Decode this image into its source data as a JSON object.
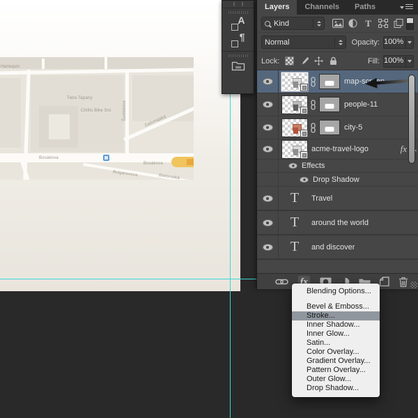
{
  "panel": {
    "tabs": [
      {
        "label": "Layers",
        "active": true
      },
      {
        "label": "Channels",
        "active": false
      },
      {
        "label": "Paths",
        "active": false
      }
    ],
    "filter_row": {
      "kind_label": "Kind",
      "filter_icons": [
        "filter-pixel-layers",
        "filter-adjustment-layers",
        "filter-type-layers",
        "filter-shape-layers",
        "filter-smart-objects"
      ],
      "toggle_icon": "layer-filtering-toggle"
    },
    "blend_row": {
      "blend_mode": "Normal",
      "opacity_label": "Opacity:",
      "opacity_value": "100%"
    },
    "lock_row": {
      "lock_label": "Lock:",
      "lock_icons": [
        "lock-transparency",
        "lock-pixels",
        "lock-position",
        "lock-all"
      ],
      "fill_label": "Fill:",
      "fill_value": "100%"
    },
    "layers": [
      {
        "name": "map-screen",
        "type": "image",
        "smart_object": true,
        "mask": true,
        "selected": true,
        "annotated": true
      },
      {
        "name": "people-11",
        "type": "image",
        "smart_object": true,
        "mask": true
      },
      {
        "name": "city-5",
        "type": "image",
        "smart_object": true,
        "mask": true
      },
      {
        "name": "acme-travel-logo",
        "type": "image",
        "smart_object": true,
        "mask": false,
        "fx_label": "fx",
        "has_effects": true
      },
      {
        "name": "Effects",
        "type": "effects-group"
      },
      {
        "name": "Drop Shadow",
        "type": "effect"
      },
      {
        "name": "Travel",
        "type": "text"
      },
      {
        "name": "around the world",
        "type": "text"
      },
      {
        "name": "and discover",
        "type": "text"
      }
    ],
    "bottom_toolbar_icons": [
      "link-layers",
      "add-layer-style",
      "add-layer-mask",
      "new-adjustment-layer",
      "new-group",
      "new-layer",
      "delete-layer"
    ]
  },
  "style_menu": {
    "items": [
      {
        "label": "Blending Options...",
        "gap_after": true
      },
      {
        "label": "Bevel & Emboss..."
      },
      {
        "label": "Stroke...",
        "highlighted": true
      },
      {
        "label": "Inner Shadow..."
      },
      {
        "label": "Inner Glow..."
      },
      {
        "label": "Satin..."
      },
      {
        "label": "Color Overlay..."
      },
      {
        "label": "Gradient Overlay..."
      },
      {
        "label": "Pattern Overlay..."
      },
      {
        "label": "Outer Glow..."
      },
      {
        "label": "Drop Shadow..."
      }
    ]
  },
  "dock": {
    "icons": [
      "character-styles",
      "paragraph-styles",
      "layer-comps"
    ]
  },
  "map": {
    "labels": [
      {
        "text": "Harlequin"
      },
      {
        "text": "Tatra Tapany"
      },
      {
        "text": "Chillis Bike Sro"
      },
      {
        "text": "Šustekova"
      },
      {
        "text": "Zadunajská"
      },
      {
        "text": "Bosákova"
      },
      {
        "text": "Bosákova"
      },
      {
        "text": "Bulgarevova"
      },
      {
        "text": "Bieloruská"
      }
    ]
  },
  "colors": {
    "guide": "#38d7d6",
    "selected_layer": "#54677d",
    "menu_highlight": "#8f969e",
    "panel_bg": "#464646",
    "pasteboard": "#292929",
    "map_highlight_road": "#f0c45e",
    "transit_marker": "#5b9bd5"
  }
}
